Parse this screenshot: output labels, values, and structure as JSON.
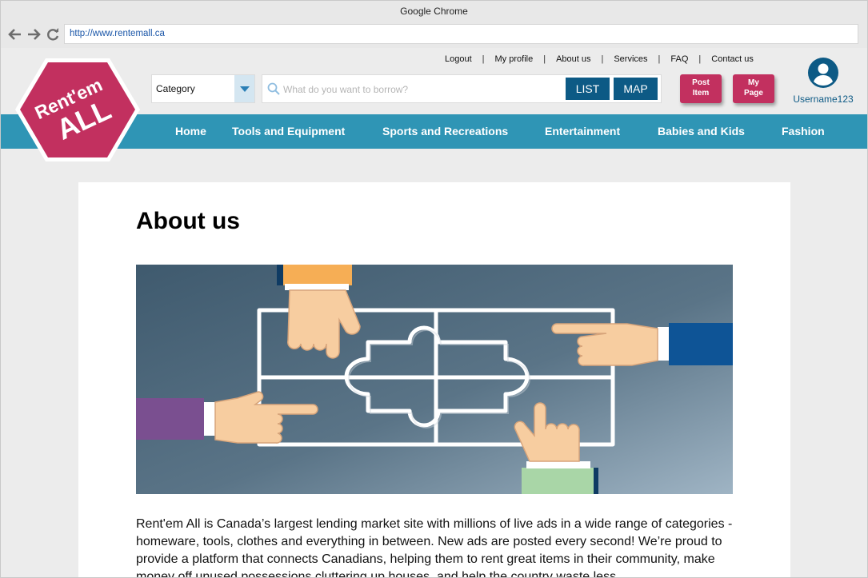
{
  "browser": {
    "title": "Google Chrome",
    "url": "http://www.rentemall.ca"
  },
  "logo": {
    "line1": "Rent'em",
    "line2": "ALL",
    "color": "#c2305f"
  },
  "top_links": [
    "Logout",
    "My profile",
    "About us",
    "Services",
    "FAQ",
    "Contact us"
  ],
  "search": {
    "category_label": "Category",
    "placeholder": "What do you want to borrow?",
    "list_label": "LIST",
    "map_label": "MAP"
  },
  "actions": {
    "post_item": [
      "Post",
      "Item"
    ],
    "my_page": [
      "My",
      "Page"
    ]
  },
  "user": {
    "name": "Username123"
  },
  "menu": [
    "Home",
    "Tools and Equipment",
    "Sports and Recreations",
    "Entertainment",
    "Babies and Kids",
    "Fashion"
  ],
  "main": {
    "title": "About us",
    "hero_image": "puzzle-hands-illustration",
    "paragraph": "Rent'em All is Canada’s largest lending market site with millions of live ads in a wide range of categories - homeware, tools, clothes and everything in between. New ads are posted every second! We’re proud to provide a platform that connects Canadians, helping them to rent great items in their community, make money off unused possessions cluttering up houses, and help the country waste less."
  },
  "colors": {
    "accent_pink": "#c2305f",
    "menu_blue": "#2f95b5",
    "button_dark": "#0d5a85"
  }
}
